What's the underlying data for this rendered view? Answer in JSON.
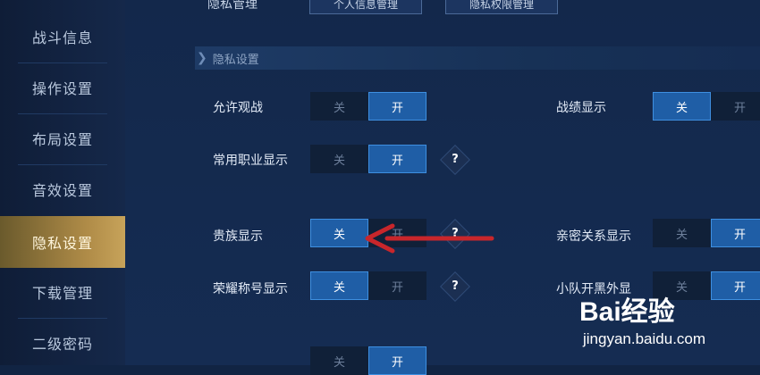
{
  "sidebar": {
    "items": [
      {
        "label": "战斗信息"
      },
      {
        "label": "操作设置"
      },
      {
        "label": "布局设置"
      },
      {
        "label": "音效设置"
      },
      {
        "label": "隐私设置"
      },
      {
        "label": "下载管理"
      },
      {
        "label": "二级密码"
      }
    ],
    "active_index": 4
  },
  "top": {
    "label": "隐私管理",
    "buttons": [
      "个人信息管理",
      "隐私权限管理"
    ]
  },
  "section": {
    "title": "隐私设置"
  },
  "toggle_labels": {
    "off": "关",
    "on": "开"
  },
  "settings": [
    {
      "label": "允许观战",
      "state": "on"
    },
    {
      "label": "战绩显示",
      "state": "off"
    },
    {
      "label": "常用职业显示",
      "state": "on"
    },
    {
      "label": "贵族显示",
      "state": "off"
    },
    {
      "label": "亲密关系显示",
      "state": "on"
    },
    {
      "label": "荣耀称号显示",
      "state": "off"
    },
    {
      "label": "小队开黑外显",
      "state": "on"
    }
  ],
  "help_glyph": "?",
  "colors": {
    "accent_on": "#1f5ea6",
    "active_tab": "#b08c48",
    "arrow": "#c8262b"
  },
  "watermark": {
    "logo": "Bai经验",
    "url": "jingyan.baidu.com"
  }
}
